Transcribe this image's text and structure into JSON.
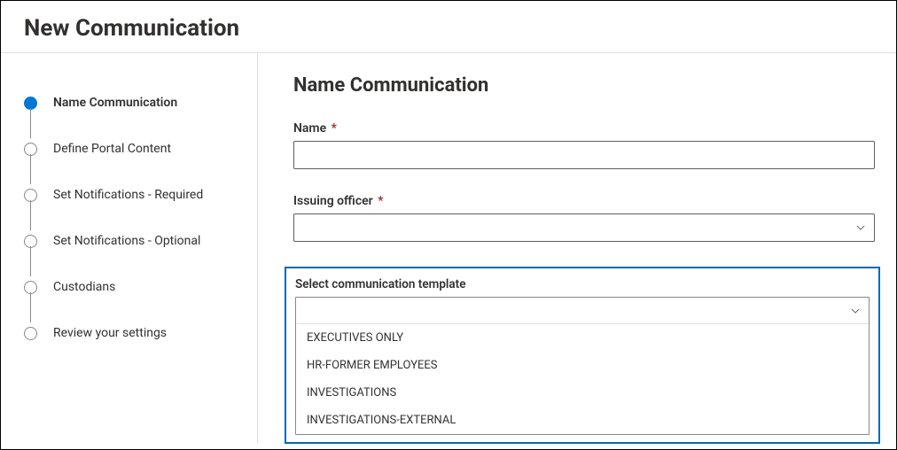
{
  "pageTitle": "New Communication",
  "stepper": {
    "steps": [
      {
        "label": "Name Communication",
        "active": true
      },
      {
        "label": "Define Portal Content",
        "active": false
      },
      {
        "label": "Set Notifications - Required",
        "active": false
      },
      {
        "label": "Set Notifications - Optional",
        "active": false
      },
      {
        "label": "Custodians",
        "active": false
      },
      {
        "label": "Review your settings",
        "active": false
      }
    ]
  },
  "panel": {
    "heading": "Name Communication",
    "name": {
      "label": "Name",
      "required": "*",
      "value": ""
    },
    "issuingOfficer": {
      "label": "Issuing officer",
      "required": "*",
      "value": ""
    },
    "template": {
      "label": "Select communication template",
      "value": "",
      "options": [
        "EXECUTIVES ONLY",
        "HR-FORMER EMPLOYEES",
        "INVESTIGATIONS",
        "INVESTIGATIONS-EXTERNAL"
      ]
    }
  }
}
